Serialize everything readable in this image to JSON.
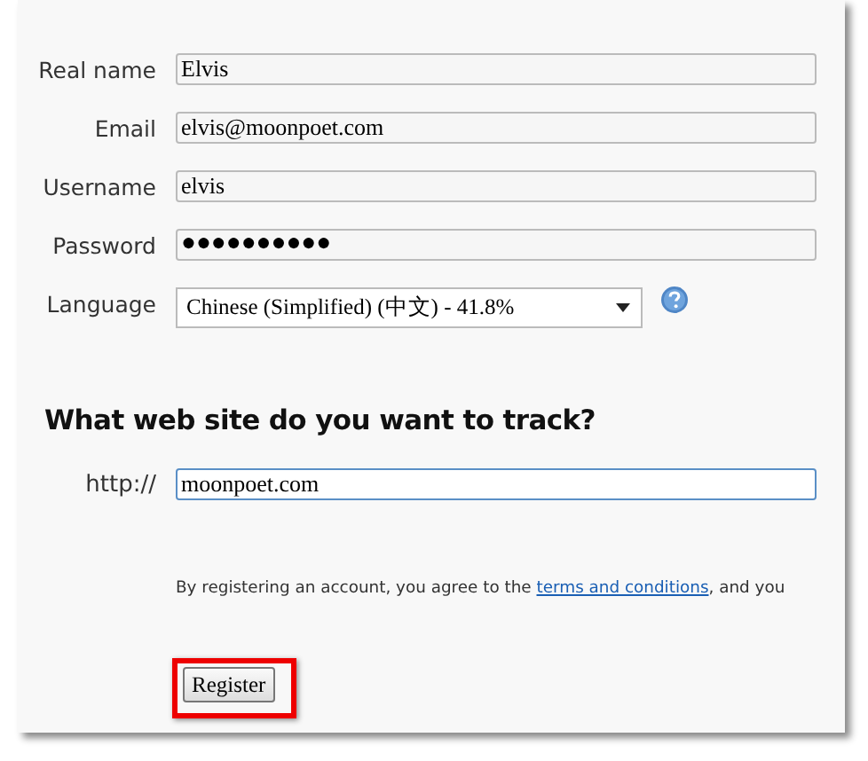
{
  "fields": [
    {
      "label": "Real name",
      "value": "Elvis",
      "kind": "text"
    },
    {
      "label": "Email",
      "value": "elvis@moonpoet.com",
      "kind": "text"
    },
    {
      "label": "Username",
      "value": "elvis",
      "kind": "text"
    },
    {
      "label": "Password",
      "value": "●●●●●●●●●●",
      "kind": "password"
    },
    {
      "label": "Language",
      "value": "Chinese (Simplified) (中文) - 41.8%",
      "kind": "select"
    }
  ],
  "site_section": {
    "heading": "What web site do you want to track?",
    "label": "http://",
    "value": "moonpoet.com",
    "focused": true
  },
  "terms": {
    "before": "By registering an account, you agree to the ",
    "link": "terms and conditions",
    "after": ", and you"
  },
  "register_button": {
    "label": "Register",
    "highlighted": true
  }
}
